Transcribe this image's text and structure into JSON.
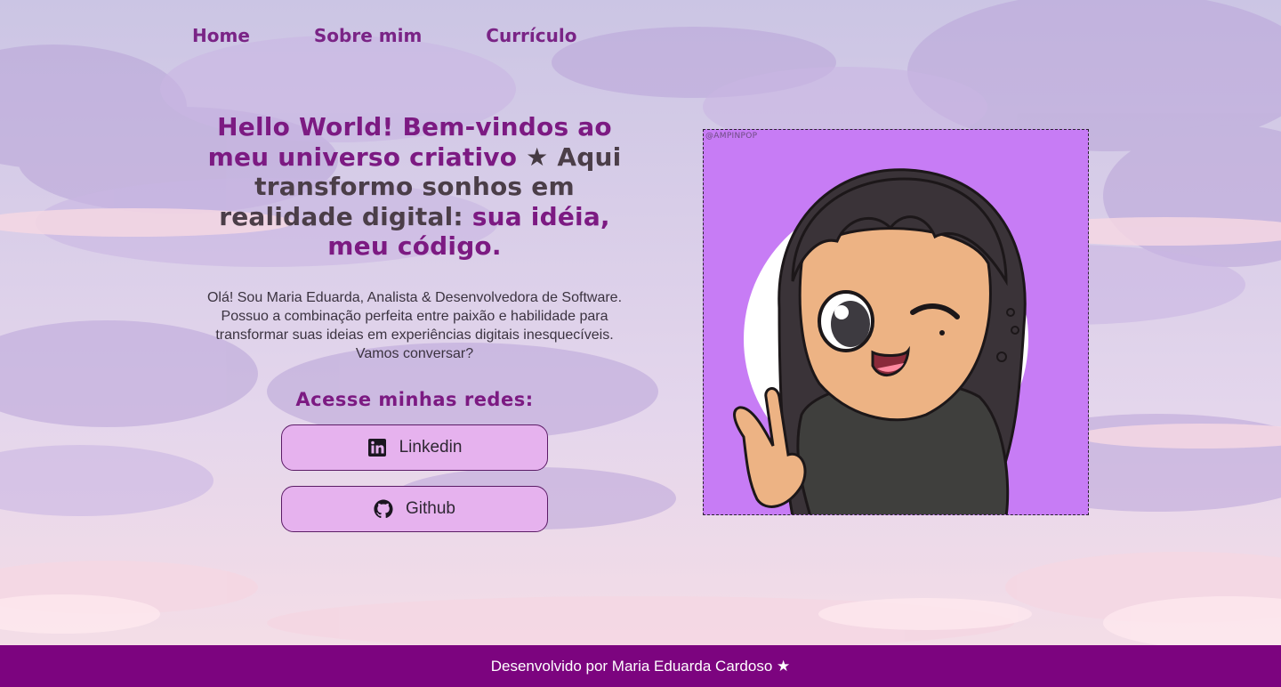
{
  "nav": {
    "items": [
      {
        "label": "Home"
      },
      {
        "label": "Sobre mim"
      },
      {
        "label": "Currículo"
      }
    ]
  },
  "hero": {
    "headline_part1": "Hello World! Bem-vindos ao meu universo criativo",
    "headline_star": "★",
    "headline_part2": "Aqui transformo sonhos em realidade digital:",
    "headline_part3": "sua idéia, meu código.",
    "intro": "Olá! Sou Maria Eduarda, Analista & Desenvolvedora de Software. Possuo a combinação perfeita entre paixão e habilidade para transformar suas ideias em experiências digitais inesquecíveis. Vamos conversar?",
    "social_title": "Acesse minhas redes:",
    "social_buttons": [
      {
        "label": "Linkedin",
        "icon": "linkedin-icon"
      },
      {
        "label": "Github",
        "icon": "github-icon"
      }
    ]
  },
  "avatar": {
    "watermark": "@AMPINPOP",
    "description_icon": "avatar-illustration"
  },
  "footer": {
    "text": "Desenvolvido por Maria Eduarda Cardoso ★"
  },
  "colors": {
    "accent": "#7c1a82",
    "footer_bg": "#7c047f",
    "button_bg": "#e6b2ee",
    "avatar_bg": "#c77cf5"
  }
}
